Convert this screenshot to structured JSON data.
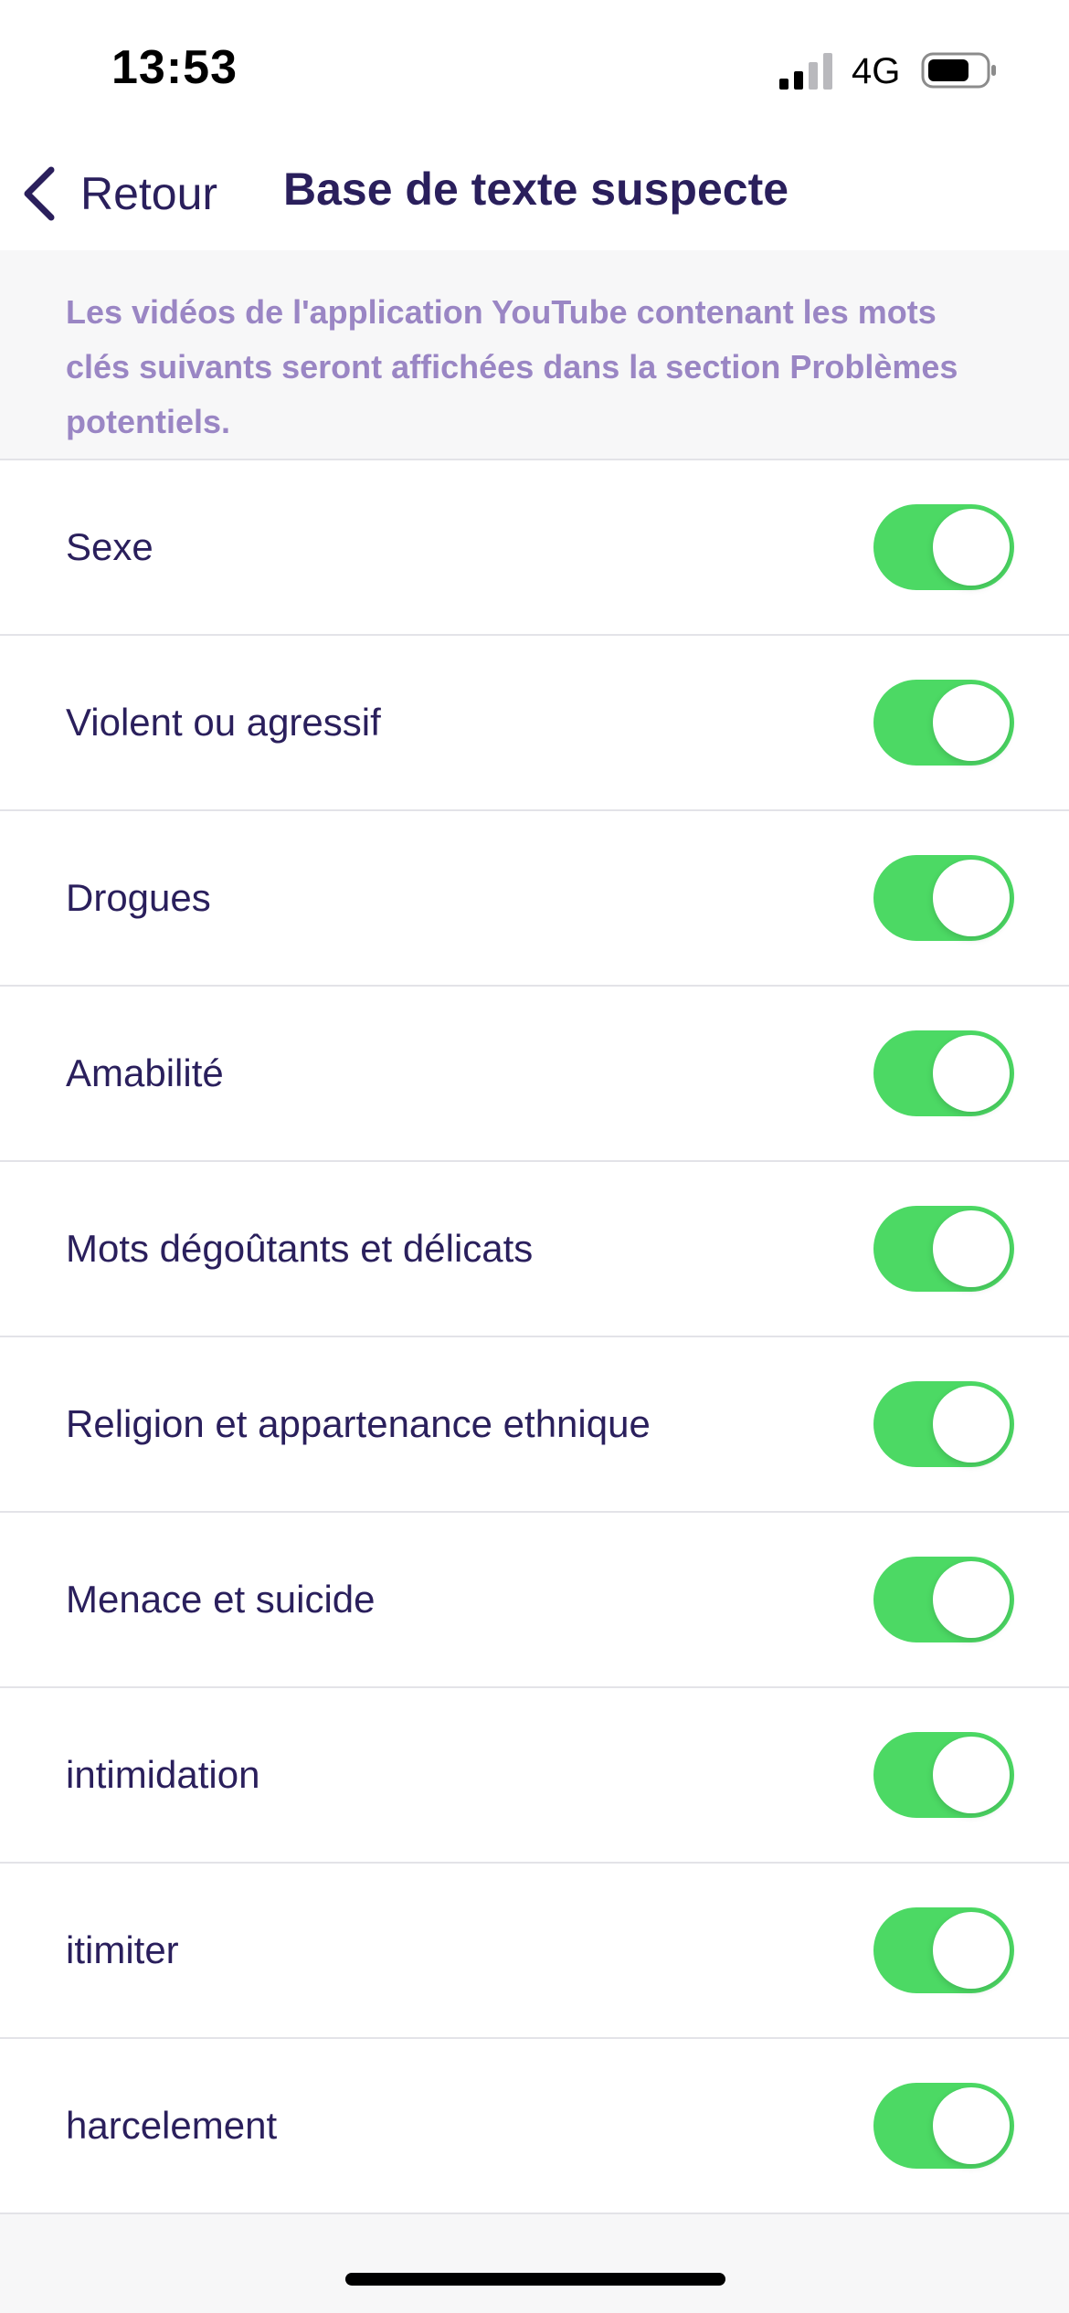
{
  "status_bar": {
    "time": "13:53",
    "network": "4G",
    "signal_icon": "cellular-signal-icon",
    "battery_icon": "battery-icon"
  },
  "nav": {
    "back_label": "Retour",
    "back_icon": "chevron-left-icon",
    "title": "Base de texte suspecte"
  },
  "info": {
    "text": "Les vidéos de l'application YouTube contenant les mots clés suivants seront affichées dans la section Problèmes potentiels."
  },
  "categories": [
    {
      "label": "Sexe",
      "enabled": true
    },
    {
      "label": "Violent ou agressif",
      "enabled": true
    },
    {
      "label": "Drogues",
      "enabled": true
    },
    {
      "label": "Amabilité",
      "enabled": true
    },
    {
      "label": "Mots dégoûtants et délicats",
      "enabled": true
    },
    {
      "label": "Religion et appartenance ethnique",
      "enabled": true
    },
    {
      "label": "Menace et suicide",
      "enabled": true
    },
    {
      "label": "intimidation",
      "enabled": true
    },
    {
      "label": "itimiter",
      "enabled": true
    },
    {
      "label": "harcelement",
      "enabled": true
    }
  ],
  "colors": {
    "accent_text": "#2a1f5c",
    "info_text": "#9a86c4",
    "toggle_on": "#4cd964",
    "background": "#f7f7f8"
  }
}
